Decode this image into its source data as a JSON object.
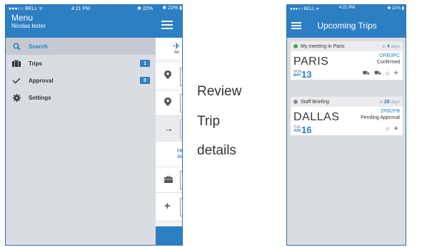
{
  "left_phone": {
    "status": {
      "carrier": "●●●○○ BELL ᯤ",
      "time": "4:21 PM",
      "battery": "✱ 22%"
    },
    "menu_title": "Menu",
    "user_name": "Nicolas lester",
    "items": [
      {
        "label": "Search",
        "icon": "search-icon",
        "badge": ""
      },
      {
        "label": "Trips",
        "icon": "luggage-icon",
        "badge": "1"
      },
      {
        "label": "Approval",
        "icon": "checkmark-icon",
        "badge": "0"
      },
      {
        "label": "Settings",
        "icon": "gear-icon",
        "badge": ""
      }
    ],
    "behind": {
      "status": "✱ 22% ▮",
      "tab_label": "Air",
      "date_line1": "FR",
      "date_line2": "JU"
    }
  },
  "caption": [
    "Review",
    "Trip",
    "details"
  ],
  "right_phone": {
    "status": {
      "carrier": "●●●○○ BELL ᯤ",
      "time": "4:21 PM",
      "battery": "✱ 22% ▮"
    },
    "title": "Upcoming Trips",
    "trips": [
      {
        "name": "My meeting in Paris",
        "in_prefix": "in",
        "in_num": "4",
        "in_unit": "days",
        "city": "PARIS",
        "dow": "MON",
        "month": "MAY",
        "day": "13",
        "code": "ORB3PC",
        "status": "Confirmed",
        "icons": "⛟ ⛟ ⌂ ✈",
        "dot_color": "#3fae49"
      },
      {
        "name": "Staff Briefing",
        "in_prefix": "in",
        "in_num": "28",
        "in_unit": "days",
        "city": "DALLAS",
        "dow": "TUE",
        "month": "JUN",
        "day": "16",
        "code": "ZRB2PB",
        "status": "Pending Approval",
        "icons": "⌂ ✈",
        "dot_color": "#8a8d92"
      }
    ]
  },
  "colors": {
    "brand_blue": "#2d7fc3",
    "confirmed_green": "#3fae49",
    "pending_gray": "#8a8d92"
  }
}
